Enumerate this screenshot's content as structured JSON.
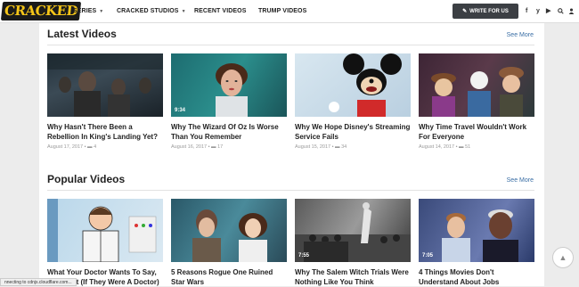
{
  "header": {
    "logo_text": "CRACKED",
    "nav": [
      {
        "label": "SERIES",
        "dropdown": true
      },
      {
        "label": "CRACKED STUDIOS",
        "dropdown": true
      },
      {
        "label": "RECENT VIDEOS",
        "dropdown": false
      },
      {
        "label": "TRUMP VIDEOS",
        "dropdown": false
      }
    ],
    "write_button": "WRITE FOR US",
    "social": [
      "f",
      "y",
      "▶",
      "ⵔ",
      "👤"
    ]
  },
  "latest": {
    "title": "Latest Videos",
    "see_more": "See More",
    "cards": [
      {
        "title": "Why Hasn't There Been a Rebellion In King's Landing Yet?",
        "date": "August 17, 2017",
        "comments": "4",
        "duration": ""
      },
      {
        "title": "Why The Wizard Of Oz Is Worse Than You Remember",
        "date": "August 16, 2017",
        "comments": "17",
        "duration": "9:34"
      },
      {
        "title": "Why We Hope Disney's Streaming Service Fails",
        "date": "August 15, 2017",
        "comments": "34",
        "duration": ""
      },
      {
        "title": "Why Time Travel Wouldn't Work For Everyone",
        "date": "August 14, 2017",
        "comments": "51",
        "duration": ""
      }
    ]
  },
  "popular": {
    "title": "Popular Videos",
    "see_more": "See More",
    "cards": [
      {
        "title": "What Your Doctor Wants To Say, But Can't (If They Were A Doctor)",
        "duration": ""
      },
      {
        "title": "5 Reasons Rogue One Ruined Star Wars",
        "duration": ""
      },
      {
        "title": "Why The Salem Witch Trials Were Nothing Like You Think",
        "duration": "7:55"
      },
      {
        "title": "4 Things Movies Don't Understand About Jobs",
        "duration": "7:05"
      }
    ]
  },
  "status_bar": "nnecting to cdnjs.cloudflare.com...",
  "colors": {
    "accent": "#3a6ea5",
    "logo": "#f5c518",
    "button": "#3c3f44"
  }
}
